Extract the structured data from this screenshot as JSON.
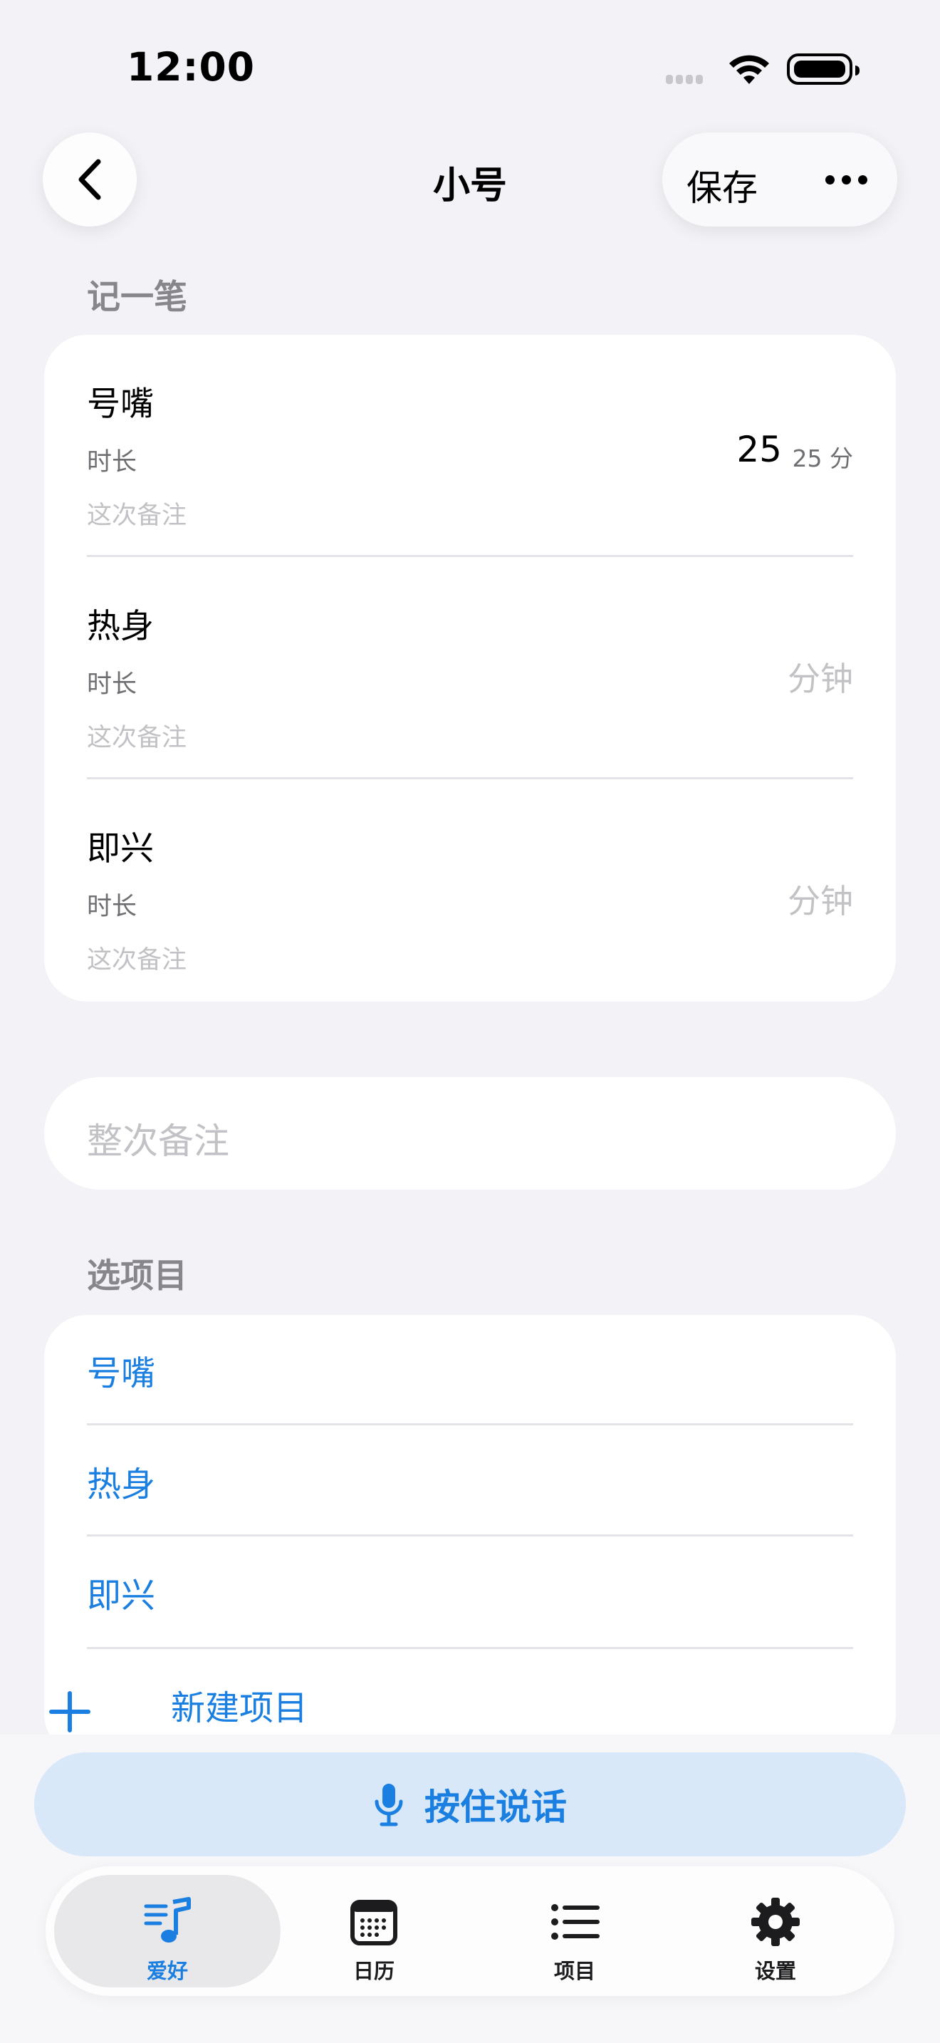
{
  "status_bar": {
    "time": "12:00"
  },
  "nav": {
    "title": "小号",
    "save_label": "保存"
  },
  "log_section": {
    "title": "记一笔",
    "entries": [
      {
        "name": "号嘴",
        "duration_label": "时长",
        "value": "25",
        "value_sub": "25 分",
        "note_placeholder": "这次备注"
      },
      {
        "name": "热身",
        "duration_label": "时长",
        "minutes_placeholder": "分钟",
        "note_placeholder": "这次备注"
      },
      {
        "name": "即兴",
        "duration_label": "时长",
        "minutes_placeholder": "分钟",
        "note_placeholder": "这次备注"
      }
    ]
  },
  "remark": {
    "placeholder": "整次备注"
  },
  "project_section": {
    "title": "选项目",
    "items": [
      "号嘴",
      "热身",
      "即兴"
    ],
    "new_item_label": "新建项目"
  },
  "voice": {
    "label": "按住说话"
  },
  "tabbar": {
    "tabs": [
      {
        "label": "爱好",
        "icon": "music-note-list-icon",
        "active": true
      },
      {
        "label": "日历",
        "icon": "calendar-icon",
        "active": false
      },
      {
        "label": "项目",
        "icon": "list-icon",
        "active": false
      },
      {
        "label": "设置",
        "icon": "gear-icon",
        "active": false
      }
    ]
  },
  "colors": {
    "accent": "#1a7fe0",
    "background": "#f2f2f7",
    "voice_bg": "#d8e8f8"
  }
}
